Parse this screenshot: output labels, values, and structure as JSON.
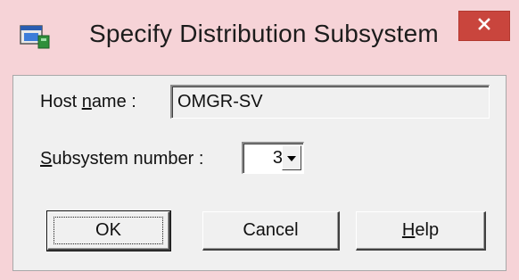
{
  "window": {
    "title": "Specify Distribution Subsystem",
    "icon": "window-app-icon",
    "close_icon": "close-icon"
  },
  "form": {
    "host_label_pre": "Host ",
    "host_label_accel": "n",
    "host_label_post": "ame :",
    "host_value": "OMGR-SV",
    "subsystem_label_accel": "S",
    "subsystem_label_post": "ubsystem number :",
    "subsystem_value": "3"
  },
  "buttons": {
    "ok": "OK",
    "cancel": "Cancel",
    "help_accel": "H",
    "help_post": "elp"
  },
  "colors": {
    "titlebar": "#f6d3d7",
    "close_button": "#c9453d",
    "client": "#f0f0f0"
  }
}
